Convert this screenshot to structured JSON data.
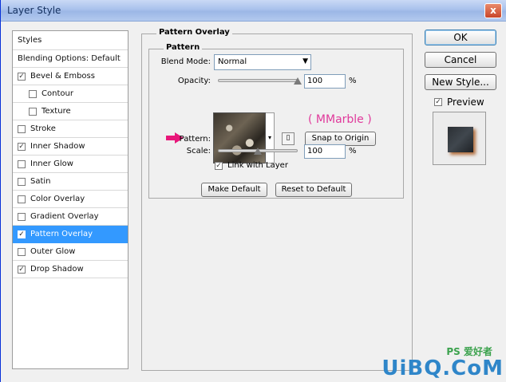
{
  "window": {
    "title": "Layer Style",
    "close_glyph": "x"
  },
  "styles_list": {
    "header": "Styles",
    "blending": "Blending Options: Default",
    "items": [
      {
        "label": "Bevel & Emboss",
        "checked": true
      },
      {
        "label": "Contour",
        "checked": false
      },
      {
        "label": "Texture",
        "checked": false
      },
      {
        "label": "Stroke",
        "checked": false
      },
      {
        "label": "Inner Shadow",
        "checked": true
      },
      {
        "label": "Inner Glow",
        "checked": false
      },
      {
        "label": "Satin",
        "checked": false
      },
      {
        "label": "Color Overlay",
        "checked": false
      },
      {
        "label": "Gradient Overlay",
        "checked": false
      },
      {
        "label": "Pattern Overlay",
        "checked": true
      },
      {
        "label": "Outer Glow",
        "checked": false
      },
      {
        "label": "Drop Shadow",
        "checked": true
      }
    ]
  },
  "panel": {
    "title": "Pattern Overlay",
    "group_title": "Pattern",
    "blend_mode_label": "Blend Mode:",
    "blend_mode_value": "Normal",
    "opacity_label": "Opacity:",
    "opacity_value": "100",
    "opacity_unit": "%",
    "opacity_fraction": 1.0,
    "pattern_label": "Pattern:",
    "pattern_name_annotation": "( MMarble )",
    "snap_label": "Snap to Origin",
    "scale_label": "Scale:",
    "scale_value": "100",
    "scale_unit": "%",
    "scale_fraction": 0.5,
    "link_label": "Link with Layer",
    "link_checked": true,
    "make_default_label": "Make Default",
    "reset_default_label": "Reset to Default"
  },
  "side_buttons": {
    "ok": "OK",
    "cancel": "Cancel",
    "new_style": "New Style...",
    "preview_label": "Preview",
    "preview_checked": true
  },
  "watermark": {
    "top": "PS 爱好者",
    "bottom": "UiBQ.CoM"
  },
  "colors": {
    "selected": "#3399ff",
    "annotation": "#e0399b",
    "arrow": "#e8177a"
  }
}
